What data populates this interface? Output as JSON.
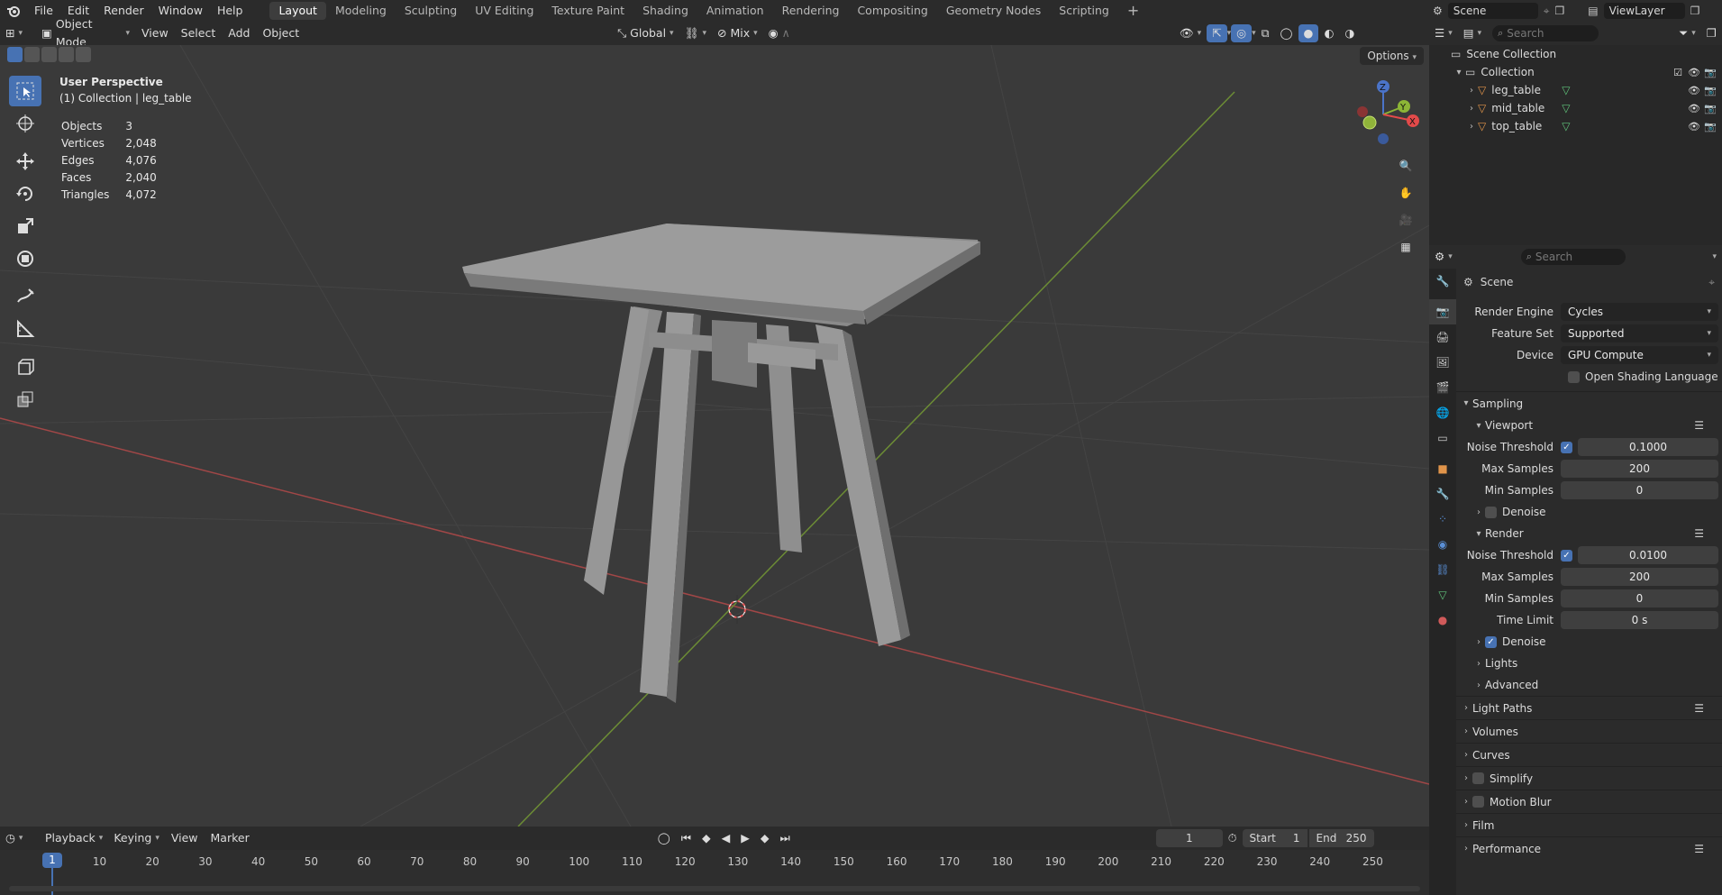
{
  "menu": {
    "file": "File",
    "edit": "Edit",
    "render": "Render",
    "window": "Window",
    "help": "Help"
  },
  "workspaces": [
    "Layout",
    "Modeling",
    "Sculpting",
    "UV Editing",
    "Texture Paint",
    "Shading",
    "Animation",
    "Rendering",
    "Compositing",
    "Geometry Nodes",
    "Scripting"
  ],
  "scene_name": "Scene",
  "view_layer": "ViewLayer",
  "vp_header": {
    "mode": "Object Mode",
    "view": "View",
    "select": "Select",
    "add": "Add",
    "object": "Object",
    "transform": "Global",
    "pivot": "Mix"
  },
  "options_label": "Options",
  "overlay": {
    "line1": "User Perspective",
    "line2": "(1) Collection | leg_table"
  },
  "stats": [
    {
      "label": "Objects",
      "value": "3"
    },
    {
      "label": "Vertices",
      "value": "2,048"
    },
    {
      "label": "Edges",
      "value": "4,076"
    },
    {
      "label": "Faces",
      "value": "2,040"
    },
    {
      "label": "Triangles",
      "value": "4,072"
    }
  ],
  "gizmo": {
    "x": "X",
    "y": "Y",
    "z": "Z"
  },
  "outliner": {
    "search_placeholder": "Search",
    "scene_collection": "Scene Collection",
    "collection": "Collection",
    "objects": [
      "leg_table",
      "mid_table",
      "top_table"
    ]
  },
  "timeline": {
    "playback": "Playback",
    "keying": "Keying",
    "view": "View",
    "marker": "Marker",
    "current_frame": "1",
    "start_label": "Start",
    "start": "1",
    "end_label": "End",
    "end": "250",
    "ticks": [
      "1",
      "10",
      "20",
      "30",
      "40",
      "50",
      "60",
      "70",
      "80",
      "90",
      "100",
      "110",
      "120",
      "130",
      "140",
      "150",
      "160",
      "170",
      "180",
      "190",
      "200",
      "210",
      "220",
      "230",
      "240",
      "250"
    ]
  },
  "props": {
    "search_placeholder": "Search",
    "context": "Scene",
    "render_engine_label": "Render Engine",
    "render_engine": "Cycles",
    "feature_set_label": "Feature Set",
    "feature_set": "Supported",
    "device_label": "Device",
    "device": "GPU Compute",
    "osl": "Open Shading Language",
    "sampling": "Sampling",
    "viewport": "Viewport",
    "noise_threshold_label": "Noise Threshold",
    "vp_noise": "0.1000",
    "max_samples_label": "Max Samples",
    "vp_max": "200",
    "min_samples_label": "Min Samples",
    "vp_min": "0",
    "denoise": "Denoise",
    "render": "Render",
    "r_noise": "0.0100",
    "r_max": "200",
    "r_min": "0",
    "time_limit_label": "Time Limit",
    "r_time": "0 s",
    "lights": "Lights",
    "advanced": "Advanced",
    "light_paths": "Light Paths",
    "volumes": "Volumes",
    "curves": "Curves",
    "simplify": "Simplify",
    "motion_blur": "Motion Blur",
    "film": "Film",
    "performance": "Performance"
  },
  "colors": {
    "accent": "#4772b3",
    "x_axis": "#c44545",
    "y_axis": "#7ea23a"
  }
}
